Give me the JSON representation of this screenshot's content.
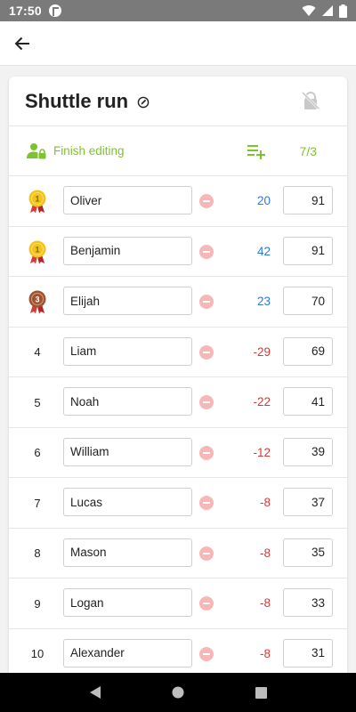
{
  "status_bar": {
    "time": "17:50"
  },
  "app_bar": {
    "back_icon": "arrow-back-icon"
  },
  "card": {
    "title": "Shuttle run",
    "finish_editing_label": "Finish editing",
    "count": "7/3"
  },
  "colors": {
    "accent_green": "#7dc32d",
    "positive_blue": "#2a7ad9",
    "negative_red": "#d33a3a",
    "gold": "#f3c417",
    "bronze": "#a0522d"
  },
  "rows": [
    {
      "rank": "1",
      "medal": "gold",
      "name": "Oliver",
      "diff": "20",
      "score": "91"
    },
    {
      "rank": "1",
      "medal": "gold",
      "name": "Benjamin",
      "diff": "42",
      "score": "91"
    },
    {
      "rank": "3",
      "medal": "bronze",
      "name": "Elijah",
      "diff": "23",
      "score": "70"
    },
    {
      "rank": "4",
      "medal": "",
      "name": "Liam",
      "diff": "-29",
      "score": "69"
    },
    {
      "rank": "5",
      "medal": "",
      "name": "Noah",
      "diff": "-22",
      "score": "41"
    },
    {
      "rank": "6",
      "medal": "",
      "name": "William",
      "diff": "-12",
      "score": "39"
    },
    {
      "rank": "7",
      "medal": "",
      "name": "Lucas",
      "diff": "-8",
      "score": "37"
    },
    {
      "rank": "8",
      "medal": "",
      "name": "Mason",
      "diff": "-8",
      "score": "35"
    },
    {
      "rank": "9",
      "medal": "",
      "name": "Logan",
      "diff": "-8",
      "score": "33"
    },
    {
      "rank": "10",
      "medal": "",
      "name": "Alexander",
      "diff": "-8",
      "score": "31"
    }
  ]
}
